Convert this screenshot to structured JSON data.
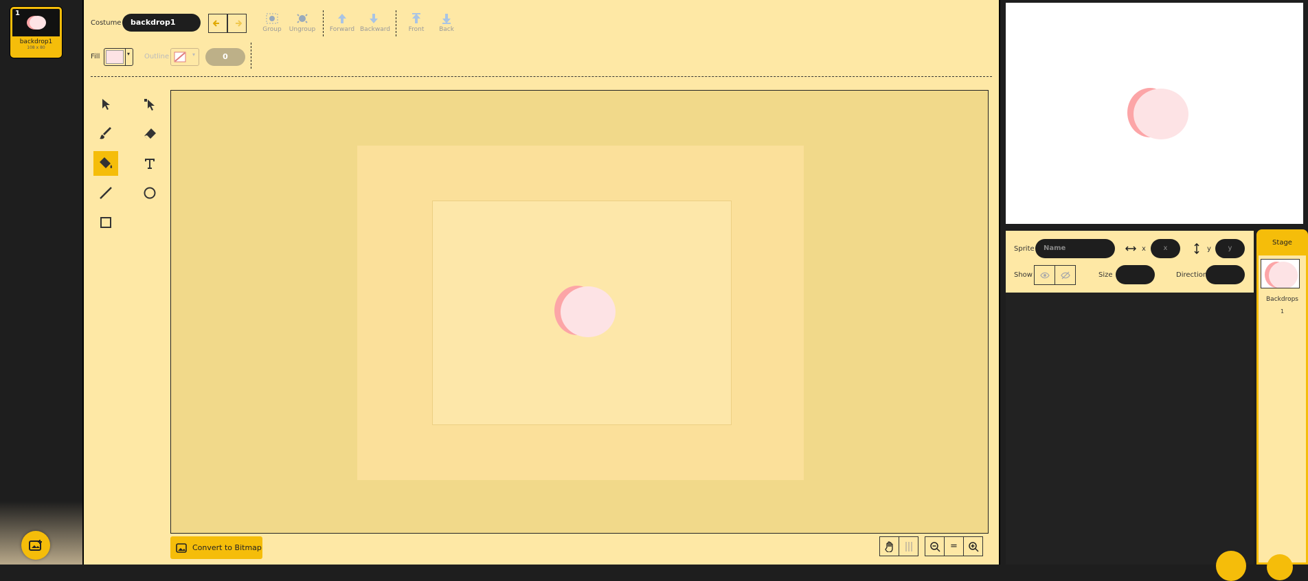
{
  "costume_list": {
    "items": [
      {
        "number": "1",
        "name": "backdrop1",
        "size": "108 x 80"
      }
    ]
  },
  "toolbar": {
    "costume_label": "Costume",
    "costume_name": "backdrop1",
    "group_label": "Group",
    "ungroup_label": "Ungroup",
    "forward_label": "Forward",
    "backward_label": "Backward",
    "front_label": "Front",
    "back_label": "Back",
    "fill_label": "Fill",
    "outline_label": "Outline",
    "outline_width": "0",
    "fill_color": "#fde3e5"
  },
  "canvas": {
    "convert_label": "Convert to Bitmap"
  },
  "sprite_info": {
    "sprite_label": "Sprite",
    "name_placeholder": "Name",
    "x_label": "x",
    "x_placeholder": "x",
    "y_label": "y",
    "y_placeholder": "y",
    "show_label": "Show",
    "size_label": "Size",
    "direction_label": "Direction"
  },
  "stage_panel": {
    "title": "Stage",
    "backdrops_label": "Backdrops",
    "backdrops_count": "1"
  },
  "colors": {
    "accent": "#f5bd0a",
    "panel_bg": "#fee8a5",
    "dark_bg": "#1e1e1e",
    "blob_dark": "#fca5a7",
    "blob_light": "#fde3e5"
  },
  "icons": [
    "select-icon",
    "reshape-icon",
    "brush-icon",
    "eraser-icon",
    "fill-icon",
    "text-icon",
    "line-icon",
    "circle-icon",
    "rectangle-icon",
    "undo-icon",
    "redo-icon",
    "zoom-out-icon",
    "zoom-reset-icon",
    "zoom-in-icon",
    "show-icon",
    "hide-icon"
  ]
}
